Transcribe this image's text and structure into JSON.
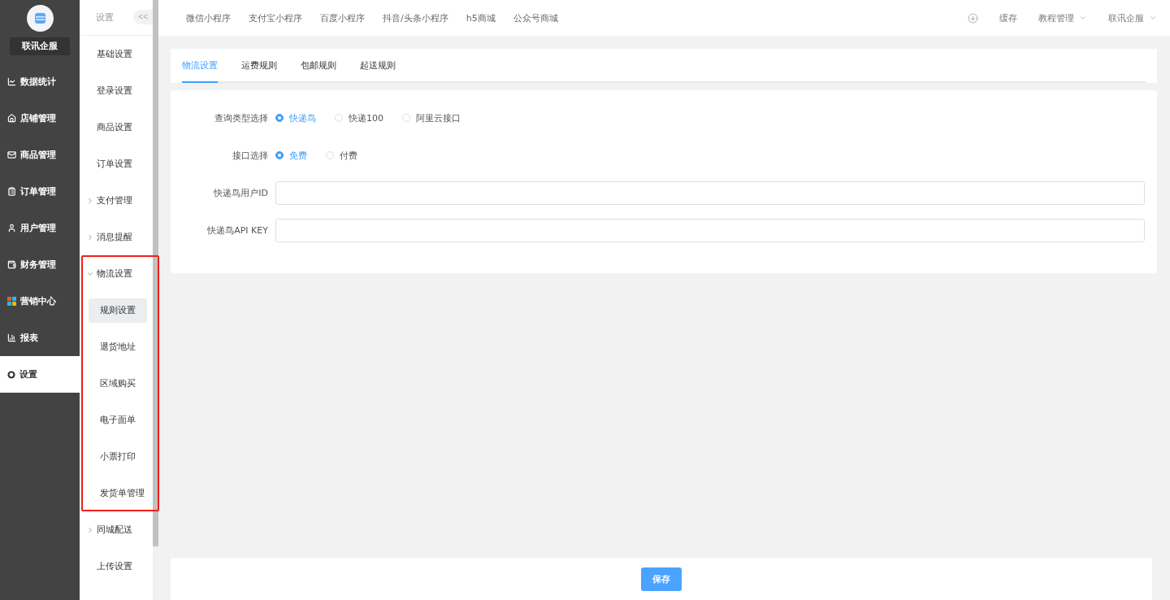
{
  "brand": {
    "name": "联讯企服"
  },
  "main_menu": [
    {
      "label": "数据统计",
      "selected": false
    },
    {
      "label": "店铺管理",
      "selected": false
    },
    {
      "label": "商品管理",
      "selected": false
    },
    {
      "label": "订单管理",
      "selected": false
    },
    {
      "label": "用户管理",
      "selected": false
    },
    {
      "label": "财务管理",
      "selected": false
    },
    {
      "label": "营销中心",
      "selected": false
    },
    {
      "label": "报表",
      "selected": false
    },
    {
      "label": "设置",
      "selected": true
    }
  ],
  "sub_menu": {
    "title": "设置",
    "collapse_button": "<<",
    "items": [
      {
        "label": "基础设置",
        "kind": "link"
      },
      {
        "label": "登录设置",
        "kind": "link"
      },
      {
        "label": "商品设置",
        "kind": "link"
      },
      {
        "label": "订单设置",
        "kind": "link"
      },
      {
        "label": "支付管理",
        "kind": "group",
        "expanded": false,
        "highlighted": false
      },
      {
        "label": "消息提醒",
        "kind": "group",
        "expanded": false,
        "highlighted": false
      },
      {
        "label": "物流设置",
        "kind": "group",
        "expanded": true,
        "highlighted": true,
        "children": [
          {
            "label": "规则设置",
            "selected": true
          },
          {
            "label": "退货地址",
            "selected": false
          },
          {
            "label": "区域购买",
            "selected": false
          },
          {
            "label": "电子面单",
            "selected": false
          },
          {
            "label": "小票打印",
            "selected": false
          },
          {
            "label": "发货单管理",
            "selected": false
          }
        ]
      },
      {
        "label": "同城配送",
        "kind": "group",
        "expanded": false,
        "highlighted": false
      },
      {
        "label": "上传设置",
        "kind": "link"
      }
    ]
  },
  "top_nav": [
    "微信小程序",
    "支付宝小程序",
    "百度小程序",
    "抖音/头条小程序",
    "h5商城",
    "公众号商城"
  ],
  "top_actions": [
    {
      "label": "缓存",
      "kind": "plain"
    },
    {
      "label": "教程管理",
      "kind": "dropdown"
    },
    {
      "label": "联讯企服",
      "kind": "dropdown"
    }
  ],
  "tabs": [
    {
      "label": "物流设置",
      "selected": true
    },
    {
      "label": "运费规则",
      "selected": false
    },
    {
      "label": "包邮规则",
      "selected": false
    },
    {
      "label": "起送规则",
      "selected": false
    }
  ],
  "form": [
    {
      "label": "查询类型选择",
      "kind": "radio",
      "options": [
        {
          "label": "快递鸟",
          "selected": true
        },
        {
          "label": "快递100",
          "selected": false
        },
        {
          "label": "阿里云接口",
          "selected": false
        }
      ]
    },
    {
      "label": "接口选择",
      "kind": "radio",
      "options": [
        {
          "label": "免费",
          "selected": true
        },
        {
          "label": "付费",
          "selected": false
        }
      ]
    },
    {
      "label": "快递鸟用户ID",
      "kind": "input"
    },
    {
      "label": "快递鸟API KEY",
      "kind": "input"
    }
  ],
  "save_button": "保存"
}
